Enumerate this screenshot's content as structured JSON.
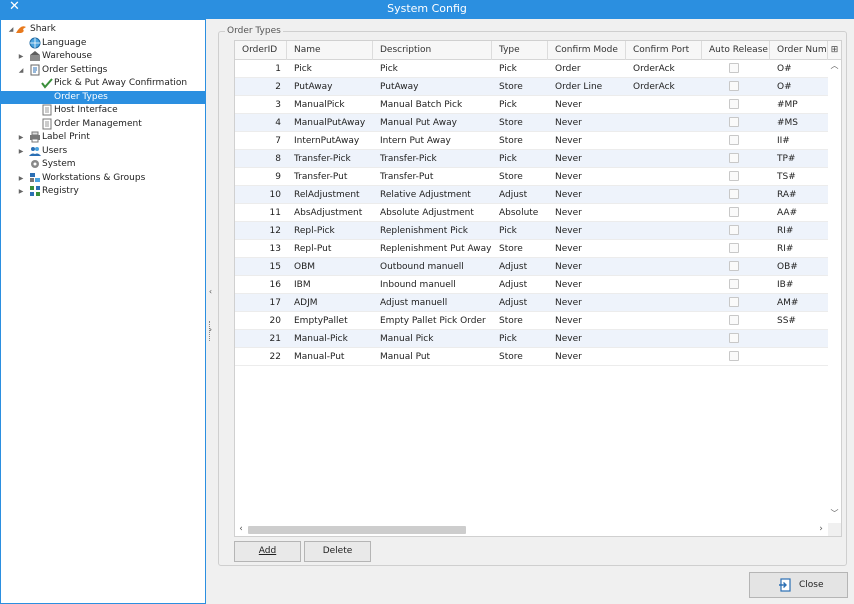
{
  "window": {
    "title": "System Config",
    "close_glyph": "✕"
  },
  "tree": {
    "items": [
      {
        "label": "Shark",
        "expander": "◢",
        "icon": "shark-logo-icon"
      },
      {
        "label": "Language",
        "expander": "",
        "icon": "globe-icon"
      },
      {
        "label": "Warehouse",
        "expander": "▶",
        "icon": "warehouse-icon"
      },
      {
        "label": "Order Settings",
        "expander": "◢",
        "icon": "order-settings-icon"
      },
      {
        "label": "Pick & Put Away Confirmation",
        "expander": "",
        "icon": "checkmark-icon"
      },
      {
        "label": "Order Types",
        "expander": "",
        "icon": "document-icon"
      },
      {
        "label": "Host Interface",
        "expander": "",
        "icon": "document-icon"
      },
      {
        "label": "Order Management",
        "expander": "",
        "icon": "document-icon"
      },
      {
        "label": "Label Print",
        "expander": "▶",
        "icon": "printer-icon"
      },
      {
        "label": "Users",
        "expander": "▶",
        "icon": "users-icon"
      },
      {
        "label": "System",
        "expander": "",
        "icon": "system-gear-icon"
      },
      {
        "label": "Workstations & Groups",
        "expander": "▶",
        "icon": "workstations-icon"
      },
      {
        "label": "Registry",
        "expander": "▶",
        "icon": "registry-icon"
      }
    ],
    "selected": "Order Types"
  },
  "group": {
    "label": "Order Types"
  },
  "table": {
    "columns": [
      "OrderID",
      "Name",
      "Description",
      "Type",
      "Confirm Mode",
      "Confirm Port",
      "Auto Release",
      "Order Number"
    ],
    "rows": [
      [
        "1",
        "Pick",
        "Pick",
        "Pick",
        "Order",
        "OrderAck",
        "",
        "O#"
      ],
      [
        "2",
        "PutAway",
        "PutAway",
        "Store",
        "Order Line",
        "OrderAck",
        "",
        "O#"
      ],
      [
        "3",
        "ManualPick",
        "Manual Batch Pick",
        "Pick",
        "Never",
        "",
        "",
        "#MP"
      ],
      [
        "4",
        "ManualPutAway",
        "Manual Put Away",
        "Store",
        "Never",
        "",
        "",
        "#MS"
      ],
      [
        "7",
        "InternPutAway",
        "Intern Put Away",
        "Store",
        "Never",
        "",
        "",
        "II#"
      ],
      [
        "8",
        "Transfer-Pick",
        "Transfer-Pick",
        "Pick",
        "Never",
        "",
        "",
        "TP#"
      ],
      [
        "9",
        "Transfer-Put",
        "Transfer-Put",
        "Store",
        "Never",
        "",
        "",
        "TS#"
      ],
      [
        "10",
        "RelAdjustment",
        "Relative Adjustment",
        "Adjust",
        "Never",
        "",
        "",
        "RA#"
      ],
      [
        "11",
        "AbsAdjustment",
        "Absolute Adjustment",
        "Absolute",
        "Never",
        "",
        "",
        "AA#"
      ],
      [
        "12",
        "Repl-Pick",
        "Replenishment Pick",
        "Pick",
        "Never",
        "",
        "",
        "RI#"
      ],
      [
        "13",
        "Repl-Put",
        "Replenishment Put Away",
        "Store",
        "Never",
        "",
        "",
        "RI#"
      ],
      [
        "15",
        "OBM",
        "Outbound manuell",
        "Adjust",
        "Never",
        "",
        "",
        "OB#"
      ],
      [
        "16",
        "IBM",
        "Inbound manuell",
        "Adjust",
        "Never",
        "",
        "",
        "IB#"
      ],
      [
        "17",
        "ADJM",
        "Adjust manuell",
        "Adjust",
        "Never",
        "",
        "",
        "AM#"
      ],
      [
        "20",
        "EmptyPallet",
        "Empty Pallet Pick Order",
        "Store",
        "Never",
        "",
        "",
        "SS#"
      ],
      [
        "21",
        "Manual-Pick",
        "Manual Pick",
        "Pick",
        "Never",
        "",
        "",
        ""
      ],
      [
        "22",
        "Manual-Put",
        "Manual Put",
        "Store",
        "Never",
        "",
        "",
        ""
      ]
    ],
    "auto_release": [
      false,
      false,
      false,
      false,
      false,
      false,
      false,
      false,
      false,
      false,
      false,
      false,
      false,
      false,
      false,
      false,
      false
    ]
  },
  "buttons": {
    "add": "Add",
    "delete": "Delete",
    "close": "Close"
  },
  "colors": {
    "accent": "#2b8fe0",
    "row_alt": "#eef3fb"
  }
}
